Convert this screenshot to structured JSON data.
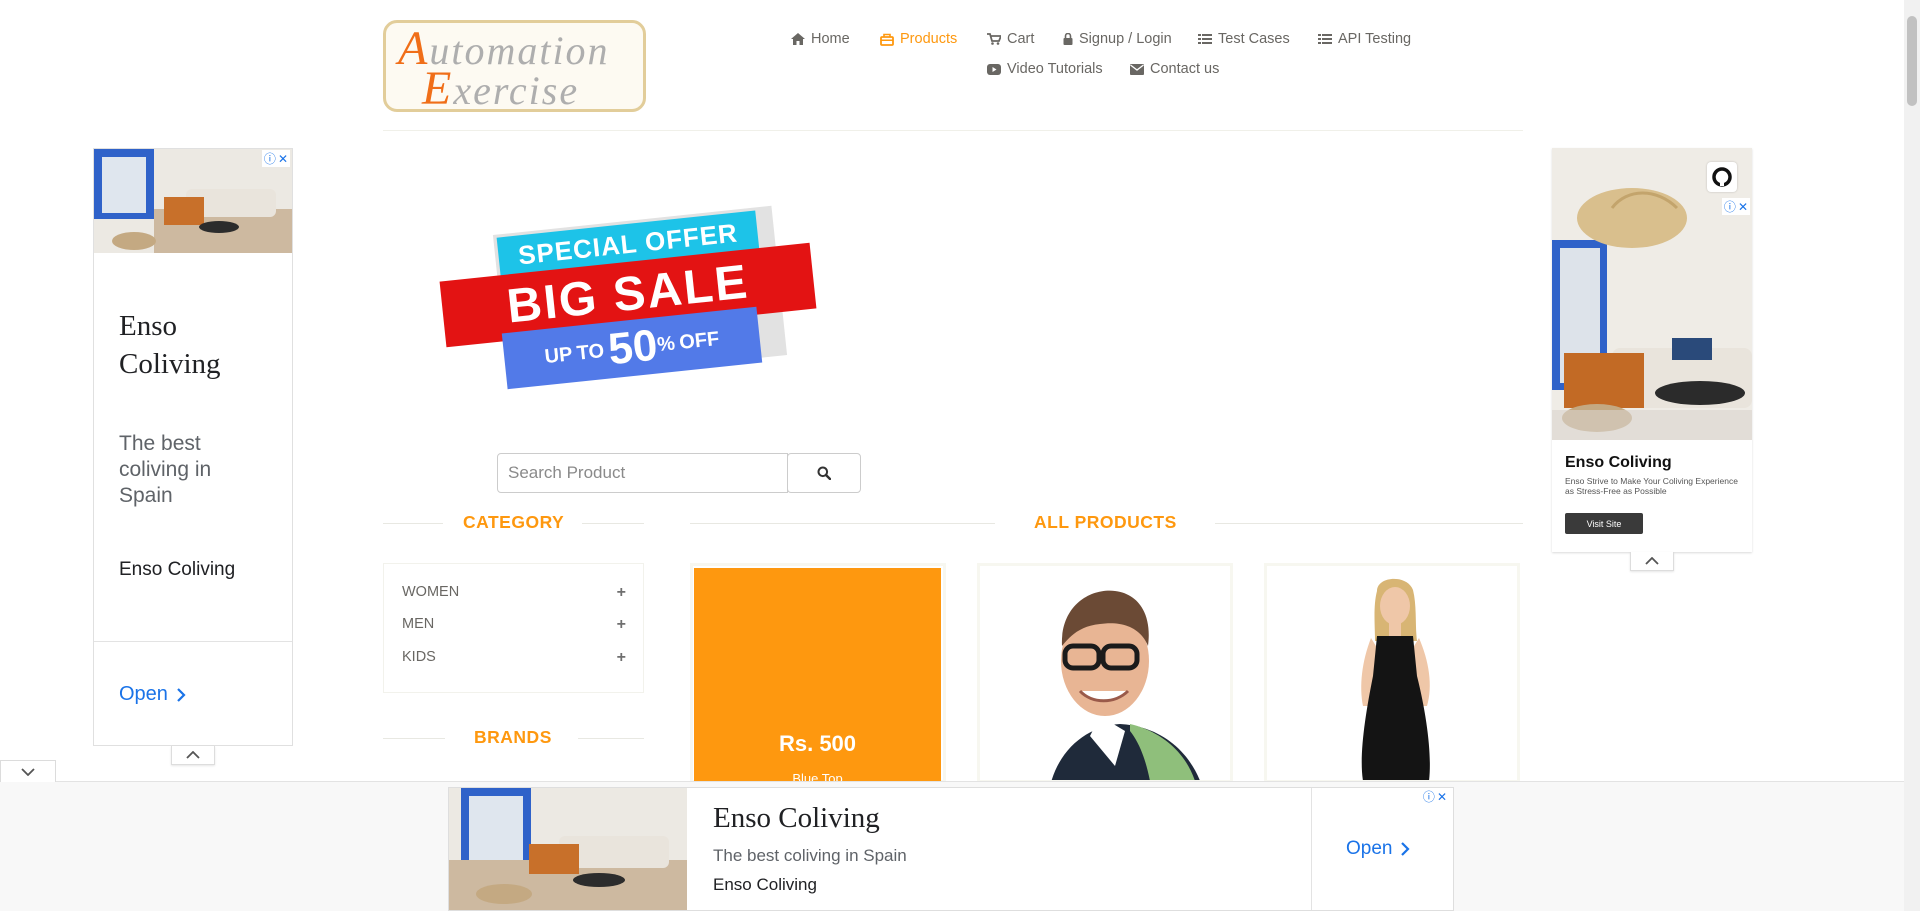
{
  "header": {
    "logo": {
      "line1": "Automation",
      "line2": "Exercise"
    },
    "nav": [
      {
        "label": "Home",
        "icon": "home-icon"
      },
      {
        "label": "Products",
        "icon": "products-icon",
        "active": true
      },
      {
        "label": "Cart",
        "icon": "cart-icon"
      },
      {
        "label": "Signup / Login",
        "icon": "lock-icon"
      },
      {
        "label": "Test Cases",
        "icon": "list-icon"
      },
      {
        "label": "API Testing",
        "icon": "list-icon"
      },
      {
        "label": "Video Tutorials",
        "icon": "youtube-icon"
      },
      {
        "label": "Contact us",
        "icon": "envelope-icon"
      }
    ],
    "accent_color": "#fe980f"
  },
  "banner": {
    "line1": "SPECIAL OFFER",
    "line2": "BIG SALE",
    "up": "UP",
    "to": "TO",
    "percent": "50",
    "percent_sign": "%",
    "off": "OFF"
  },
  "search": {
    "placeholder": "Search Product",
    "value": ""
  },
  "sidebar": {
    "category_title": "CATEGORY",
    "categories": [
      {
        "label": "WOMEN"
      },
      {
        "label": "MEN"
      },
      {
        "label": "KIDS"
      }
    ],
    "brands_title": "BRANDS"
  },
  "products": {
    "title": "ALL PRODUCTS",
    "items": [
      {
        "price": "Rs. 500",
        "name": "Blue Top",
        "overlay": true
      },
      {
        "image": "man-with-glasses"
      },
      {
        "image": "woman-black-dress"
      }
    ]
  },
  "ads": {
    "left": {
      "title": "Enso Coliving",
      "subtitle": "The best coliving in Spain",
      "advertiser": "Enso Coliving",
      "cta": "Open"
    },
    "right": {
      "title": "Enso Coliving",
      "description": "Enso Strive to Make Your Coliving Experience as Stress-Free as Possible",
      "cta": "Visit Site"
    },
    "bottom": {
      "title": "Enso Coliving",
      "subtitle": "The best coliving in Spain",
      "advertiser": "Enso Coliving",
      "cta": "Open"
    }
  }
}
